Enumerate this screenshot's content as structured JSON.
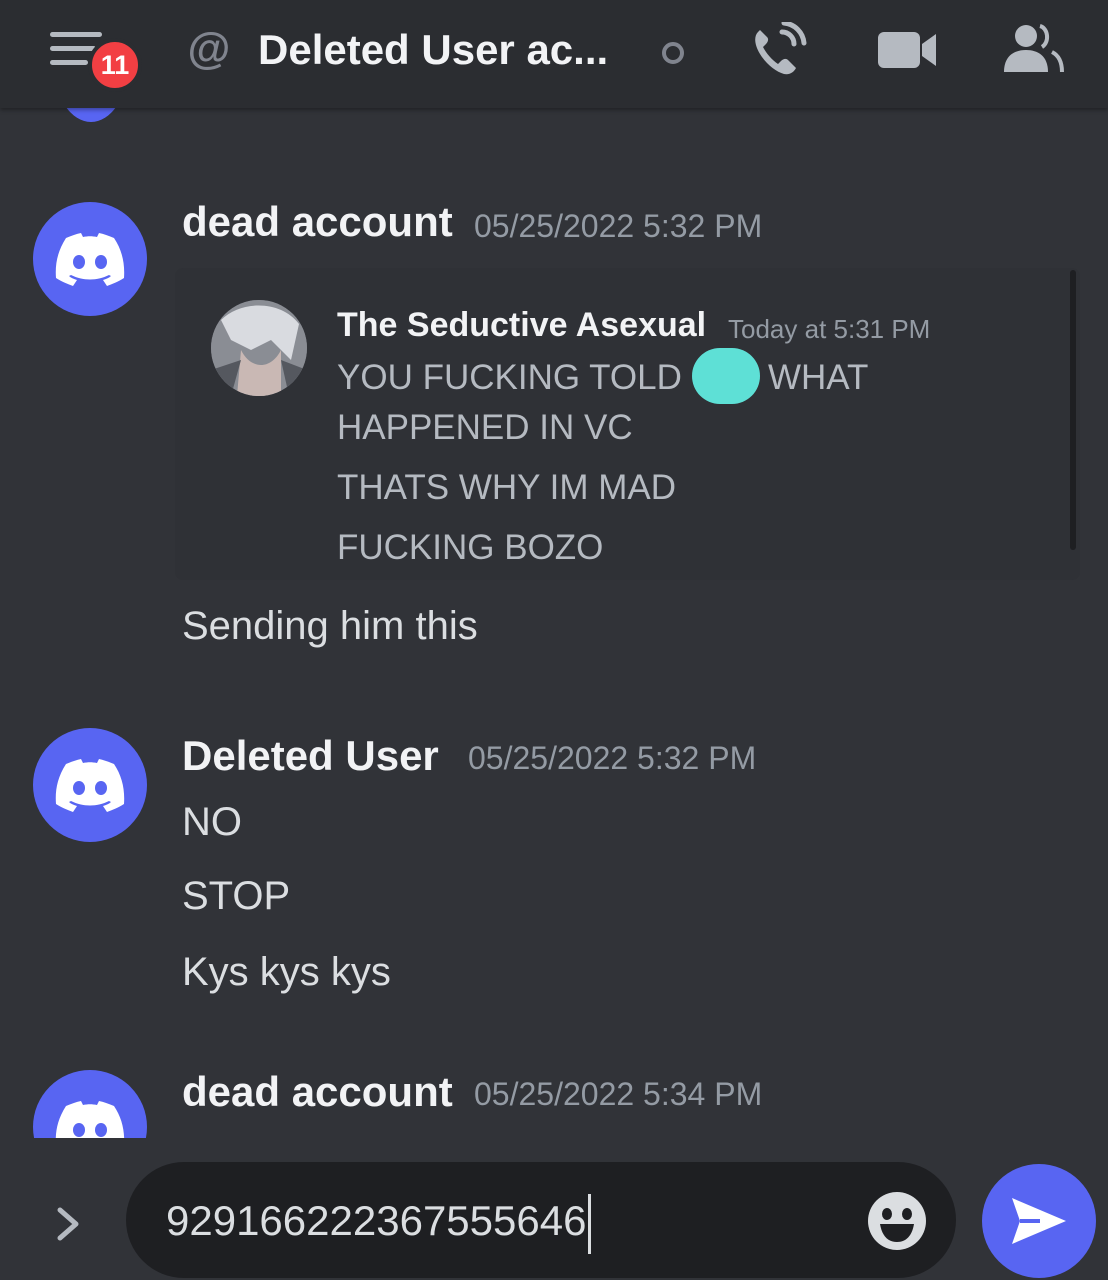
{
  "header": {
    "unread_badge": "11",
    "at_symbol": "@",
    "channel_title": "Deleted User ac...",
    "icons": [
      "hamburger-menu-icon",
      "at-icon",
      "status-offline-icon",
      "voice-call-icon",
      "video-call-icon",
      "member-list-icon"
    ]
  },
  "messages": [
    {
      "author": "dead account",
      "timestamp": "05/25/2022 5:32 PM",
      "quote": {
        "author": "The Seductive Asexual",
        "timestamp": "Today at 5:31 PM",
        "line1_before": "YOU FUCKING TOLD",
        "line1_after": "WHAT",
        "line2": "HAPPENED IN VC",
        "line3": "THATS WHY IM MAD",
        "line4": "FUCKING BOZO"
      },
      "text": "Sending him this"
    },
    {
      "author": "Deleted User",
      "timestamp": "05/25/2022 5:32 PM",
      "lines": [
        "NO",
        "STOP",
        "Kys kys kys"
      ]
    },
    {
      "author": "dead account",
      "timestamp": "05/25/2022 5:34 PM"
    }
  ],
  "composer": {
    "input_value": "929166222367555646"
  },
  "colors": {
    "background": "#313338",
    "header": "#2b2d31",
    "blurple": "#5865f2",
    "badge_red": "#f23f43",
    "redaction": "#5ee0d6"
  }
}
